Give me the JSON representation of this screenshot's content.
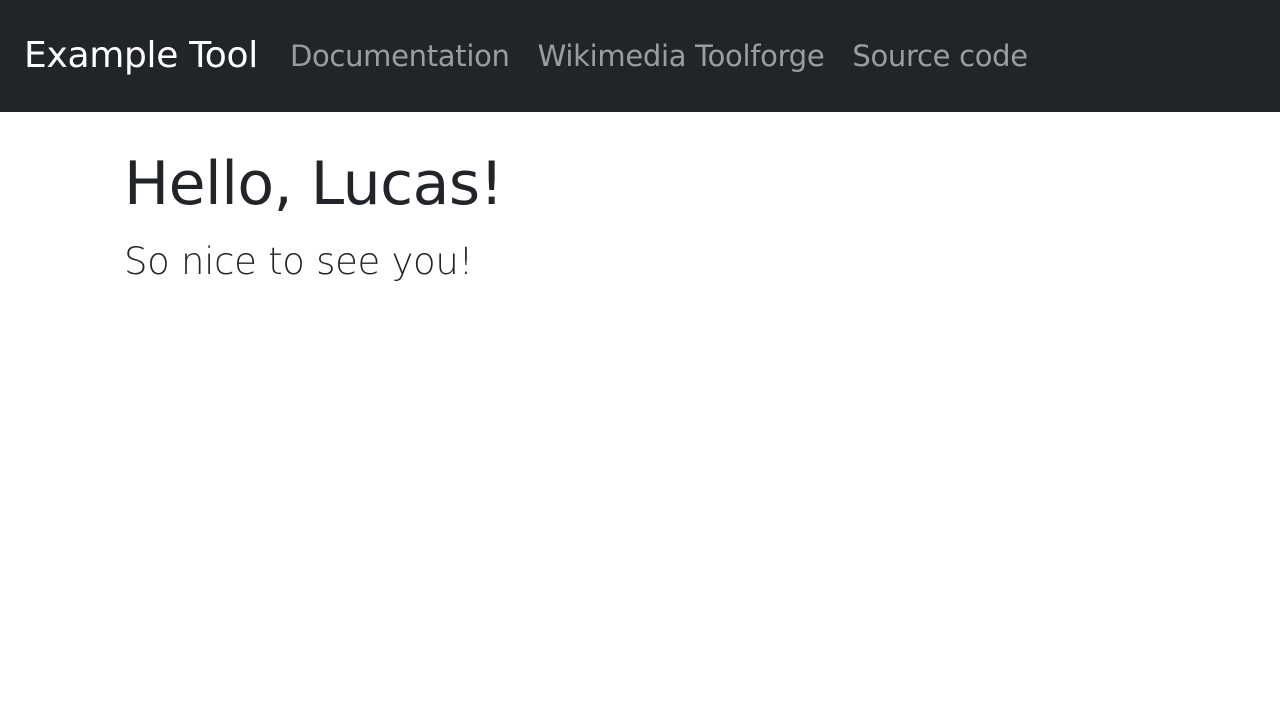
{
  "navbar": {
    "brand": "Example Tool",
    "links": [
      {
        "label": "Documentation"
      },
      {
        "label": "Wikimedia Toolforge"
      },
      {
        "label": "Source code"
      }
    ]
  },
  "main": {
    "title": "Hello, Lucas!",
    "lead": "So nice to see you!"
  },
  "colors": {
    "navbar_bg": "#212529",
    "brand_text": "#ffffff",
    "link_text": "#9a9c9f",
    "body_text": "#212529",
    "page_bg": "#ffffff"
  }
}
